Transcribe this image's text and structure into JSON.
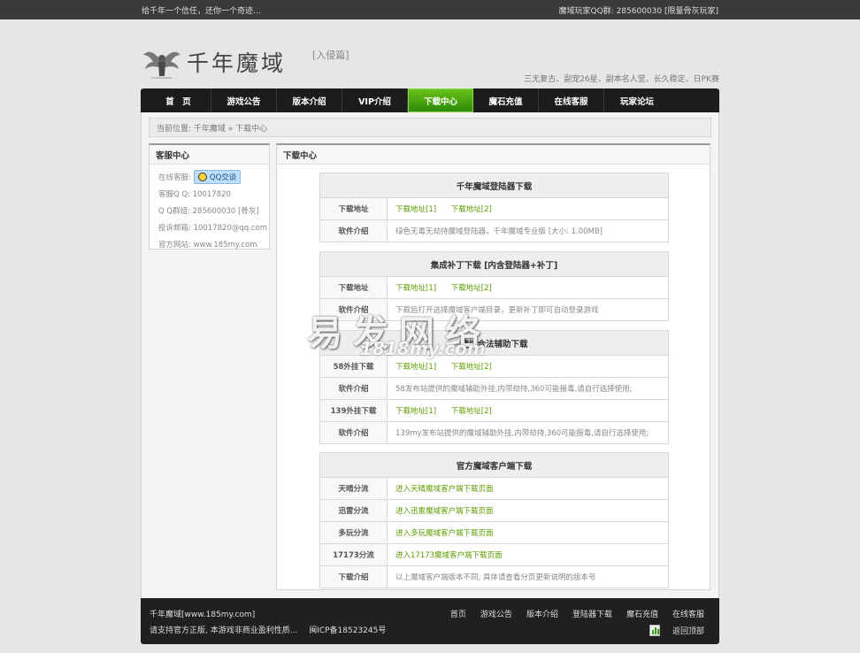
{
  "topbar": {
    "left": "给千年一个信任，还你一个奇迹...",
    "right": "魔域玩家QQ群: 285600030 [限量骨灰玩家]"
  },
  "header": {
    "logo_text": "千年魔域",
    "logo_sub": "[入侵篇]",
    "slogan": "三无复古、副宠26星、副本名人堂、长久稳定、日PK赛"
  },
  "nav": [
    {
      "label": "首　页",
      "active": false
    },
    {
      "label": "游戏公告",
      "active": false
    },
    {
      "label": "版本介绍",
      "active": false
    },
    {
      "label": "VIP介绍",
      "active": false
    },
    {
      "label": "下载中心",
      "active": true
    },
    {
      "label": "魔石充值",
      "active": false
    },
    {
      "label": "在线客服",
      "active": false
    },
    {
      "label": "玩家论坛",
      "active": false
    }
  ],
  "breadcrumb": "当前位置: 千年魔域 » 下载中心",
  "sidebar": {
    "title": "客服中心",
    "online_label": "在线客服:",
    "qq_button": "QQ交谈",
    "rows": [
      "客服Q Q: 10017820",
      "Q Q群组: 285600030 [骨灰]",
      "投诉邮箱: 10017820@qq.com",
      "官方网站: www.185my.com"
    ]
  },
  "main": {
    "title": "下载中心",
    "tables": [
      {
        "title": "千年魔域登陆器下载",
        "rows": [
          {
            "label": "下载地址",
            "links": [
              "下载地址[1]",
              "下载地址[2]"
            ]
          },
          {
            "label": "软件介绍",
            "text": "绿色无毒无劫持魔域登陆器，千年魔域专业版 [大小: 1.00MB]"
          }
        ]
      },
      {
        "title": "集成补丁下载 [内含登陆器+补丁]",
        "rows": [
          {
            "label": "下载地址",
            "links": [
              "下载地址[1]",
              "下载地址[2]"
            ]
          },
          {
            "label": "软件介绍",
            "text": "下载后打开选择魔域客户端目录，更新补丁即可自动登录游戏"
          }
        ]
      },
      {
        "title": "魔域合法辅助下载",
        "rows": [
          {
            "label": "58外挂下载",
            "links": [
              "下载地址[1]",
              "下载地址[2]"
            ]
          },
          {
            "label": "软件介绍",
            "text": "58发布站提供的魔域辅助外挂,内带劫持,360可能报毒,请自行选择使用;"
          },
          {
            "label": "139外挂下载",
            "links": [
              "下载地址[1]",
              "下载地址[2]"
            ]
          },
          {
            "label": "软件介绍",
            "text": "139my发布站提供的魔域辅助外挂,内带劫持,360可能报毒,请自行选择使用;"
          }
        ]
      },
      {
        "title": "官方魔域客户端下载",
        "rows": [
          {
            "label": "天晴分流",
            "links": [
              "进入天晴魔域客户端下载页面"
            ]
          },
          {
            "label": "迅雷分流",
            "links": [
              "进入迅雷魔域客户端下载页面"
            ]
          },
          {
            "label": "多玩分流",
            "links": [
              "进入多玩魔域客户端下载页面"
            ]
          },
          {
            "label": "17173分流",
            "links": [
              "进入17173魔域客户端下载页面"
            ]
          },
          {
            "label": "下载介绍",
            "text": "以上魔域客户端版本不同, 具体请查看分页更新说明的版本号"
          }
        ]
      }
    ]
  },
  "footer": {
    "site": "千年魔域[www.185my.com]",
    "notice": "请支持官方正版, 本游戏非商业盈利性质...",
    "icp": "闽ICP备18523245号",
    "links": [
      "首页",
      "游戏公告",
      "版本介绍",
      "登陆器下载",
      "魔石充值",
      "在线客服"
    ],
    "back_top": "返回顶部"
  },
  "watermark": {
    "cn": "易发网络",
    "en": "1818my.com"
  },
  "colors": {
    "nav_bg": "#1c1c1c",
    "nav_active": "#3a9a0a",
    "link": "#5c9c00"
  }
}
